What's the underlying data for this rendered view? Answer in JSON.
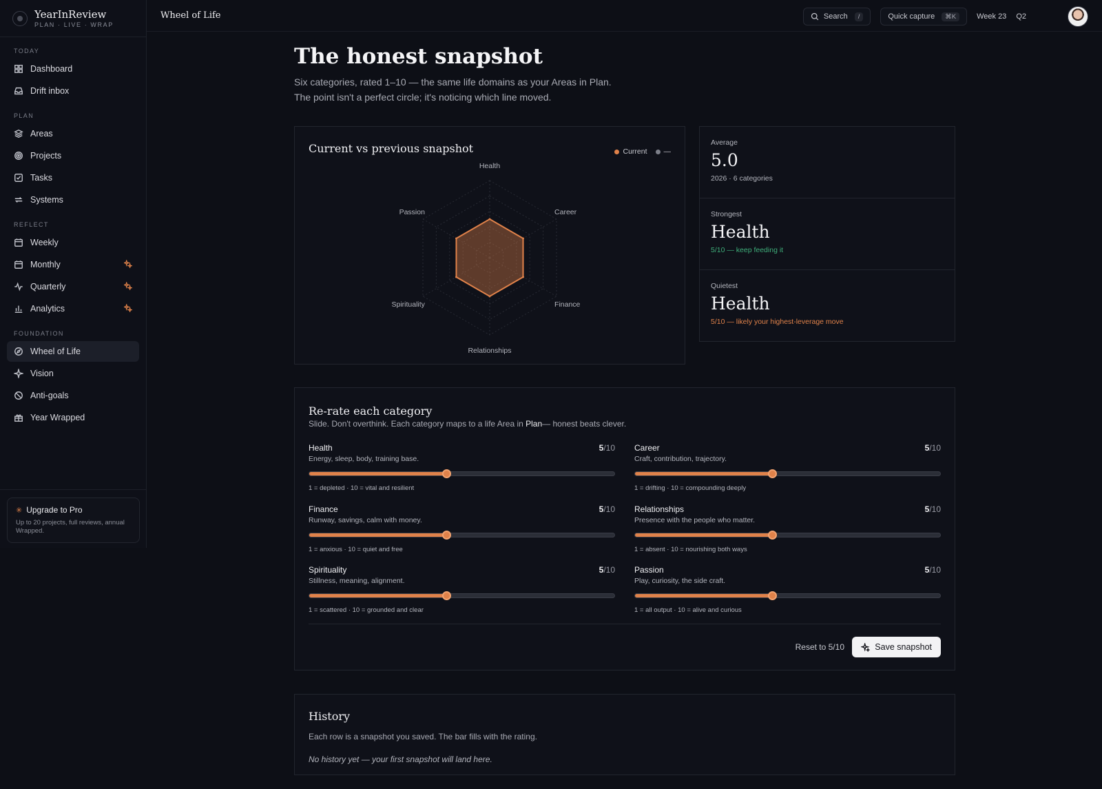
{
  "app": {
    "name": "YearInReview",
    "tagline": "PLAN · LIVE · WRAP"
  },
  "sidebar": {
    "sections": [
      {
        "label": "TODAY",
        "items": [
          {
            "label": "Dashboard",
            "icon": "grid-icon"
          },
          {
            "label": "Drift inbox",
            "icon": "inbox-icon"
          }
        ]
      },
      {
        "label": "PLAN",
        "items": [
          {
            "label": "Areas",
            "icon": "layers-icon"
          },
          {
            "label": "Projects",
            "icon": "target-icon"
          },
          {
            "label": "Tasks",
            "icon": "checkbox-icon"
          },
          {
            "label": "Systems",
            "icon": "repeat-icon"
          }
        ]
      },
      {
        "label": "REFLECT",
        "items": [
          {
            "label": "Weekly",
            "icon": "calendar-icon"
          },
          {
            "label": "Monthly",
            "icon": "calendar-icon",
            "pro": true
          },
          {
            "label": "Quarterly",
            "icon": "activity-icon",
            "pro": true
          },
          {
            "label": "Analytics",
            "icon": "bar-chart-icon",
            "pro": true
          }
        ]
      },
      {
        "label": "FOUNDATION",
        "items": [
          {
            "label": "Wheel of Life",
            "icon": "compass-icon",
            "active": true
          },
          {
            "label": "Vision",
            "icon": "sparkle-icon"
          },
          {
            "label": "Anti-goals",
            "icon": "ban-icon"
          },
          {
            "label": "Year Wrapped",
            "icon": "gift-icon"
          }
        ]
      }
    ],
    "upgrade": {
      "title": "Upgrade to Pro",
      "desc": "Up to 20 projects, full reviews, annual Wrapped."
    }
  },
  "topbar": {
    "title": "Wheel of Life",
    "search_label": "Search",
    "search_kbd": "/",
    "capture_label": "Quick capture",
    "capture_kbd": "⌘K",
    "week": "Week 23",
    "quarter": "Q2"
  },
  "page": {
    "title": "The honest snapshot",
    "subtitle_line1": "Six categories, rated 1–10 — the same life domains as your Areas in Plan.",
    "subtitle_line2": "The point isn't a perfect circle; it's noticing which line moved."
  },
  "chart_card": {
    "title": "Current vs previous snapshot",
    "legend_current": "Current",
    "legend_previous": "—"
  },
  "chart_data": {
    "type": "radar",
    "categories": [
      "Health",
      "Career",
      "Finance",
      "Relationships",
      "Spirituality",
      "Passion"
    ],
    "series": [
      {
        "name": "Current",
        "values": [
          5,
          5,
          5,
          5,
          5,
          5
        ],
        "color": "#e0824a"
      }
    ],
    "rlim": [
      0,
      10
    ]
  },
  "stats": {
    "average": {
      "label": "Average",
      "value": "5.0",
      "note": "2026 · 6 categories"
    },
    "strongest": {
      "label": "Strongest",
      "value": "Health",
      "note": "5/10 — keep feeding it",
      "color": "#3fae7a"
    },
    "quietest": {
      "label": "Quietest",
      "value": "Health",
      "note": "5/10 — likely your highest-leverage move",
      "color": "#e0824a"
    }
  },
  "rate": {
    "title": "Re-rate each category",
    "sub_before": "Slide. Don't overthink. Each category maps to a life Area in ",
    "sub_bold": "Plan",
    "sub_after": "— honest beats clever.",
    "max_label": "/10",
    "categories": [
      {
        "name": "Health",
        "desc": "Energy, sleep, body, training base.",
        "score": 5,
        "scale": "1 = depleted · 10 = vital and resilient"
      },
      {
        "name": "Career",
        "desc": "Craft, contribution, trajectory.",
        "score": 5,
        "scale": "1 = drifting · 10 = compounding deeply"
      },
      {
        "name": "Finance",
        "desc": "Runway, savings, calm with money.",
        "score": 5,
        "scale": "1 = anxious · 10 = quiet and free"
      },
      {
        "name": "Relationships",
        "desc": "Presence with the people who matter.",
        "score": 5,
        "scale": "1 = absent · 10 = nourishing both ways"
      },
      {
        "name": "Spirituality",
        "desc": "Stillness, meaning, alignment.",
        "score": 5,
        "scale": "1 = scattered · 10 = grounded and clear"
      },
      {
        "name": "Passion",
        "desc": "Play, curiosity, the side craft.",
        "score": 5,
        "scale": "1 = all output · 10 = alive and curious"
      }
    ],
    "reset_label": "Reset to 5/10",
    "save_label": "Save snapshot"
  },
  "history": {
    "title": "History",
    "sub": "Each row is a snapshot you saved. The bar fills with the rating.",
    "empty": "No history yet — your first snapshot will land here."
  },
  "colors": {
    "accent": "#e0824a",
    "positive": "#3fae7a",
    "background": "#0d0f16"
  }
}
